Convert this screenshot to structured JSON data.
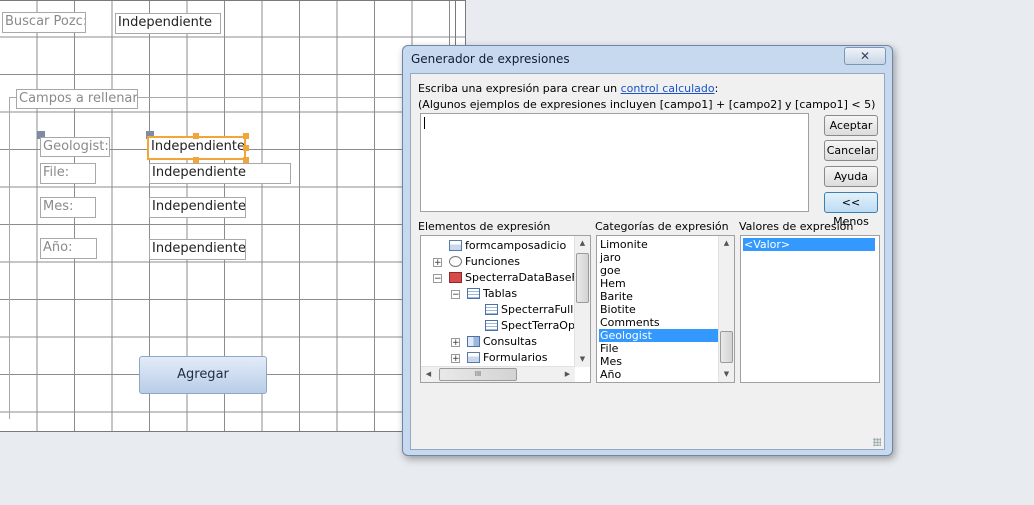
{
  "form": {
    "buscar_label": "Buscar Pozc:",
    "buscar_value": "Independiente",
    "group_label": "Campos a rellenar:",
    "fields": [
      {
        "label": "Geologist:",
        "value": "Independiente"
      },
      {
        "label": "File:",
        "value": "Independiente"
      },
      {
        "label": "Mes:",
        "value": "Independiente"
      },
      {
        "label": "Año:",
        "value": "Independiente"
      }
    ],
    "agregar_label": "Agregar"
  },
  "dialog": {
    "title": "Generador de expresiones",
    "close_glyph": "✕",
    "instruction_prefix": "Escriba una expresión para crear un ",
    "instruction_link": "control calculado",
    "instruction_suffix": ":",
    "example_text": "(Algunos ejemplos de expresiones incluyen [campo1] + [campo2] y [campo1] < 5)",
    "expression_value": "",
    "buttons": {
      "accept": "Aceptar",
      "cancel": "Cancelar",
      "help": "Ayuda",
      "less": "<< Menos"
    },
    "elements_header": "Elementos de expresión",
    "categories_header": "Categorías de expresión",
    "values_header": "Valores de expresión",
    "elements_tree": [
      {
        "label": "formcamposadicio",
        "icon": "form-icon",
        "indent": 1,
        "expander": ""
      },
      {
        "label": "Funciones",
        "icon": "function-icon",
        "indent": 1,
        "expander": "+"
      },
      {
        "label": "SpecterraDataBaseFull",
        "icon": "database-icon",
        "indent": 1,
        "expander": "−"
      },
      {
        "label": "Tablas",
        "icon": "table-icon",
        "indent": 2,
        "expander": "−"
      },
      {
        "label": "SpecterraFull",
        "icon": "table-icon",
        "indent": 3,
        "expander": ""
      },
      {
        "label": "SpectTerraOpt",
        "icon": "table-icon",
        "indent": 3,
        "expander": ""
      },
      {
        "label": "Consultas",
        "icon": "query-icon",
        "indent": 2,
        "expander": "+"
      },
      {
        "label": "Formularios",
        "icon": "form-icon",
        "indent": 2,
        "expander": "+"
      }
    ],
    "categories": [
      "Limonite",
      "jaro",
      "goe",
      "Hem",
      "Barite",
      "Biotite",
      "Comments",
      "Geologist",
      "File",
      "Mes",
      "Año"
    ],
    "selected_category": "Geologist",
    "values": [
      "<Valor>"
    ],
    "selected_value": "<Valor>",
    "scroll_h_grip": "III"
  }
}
